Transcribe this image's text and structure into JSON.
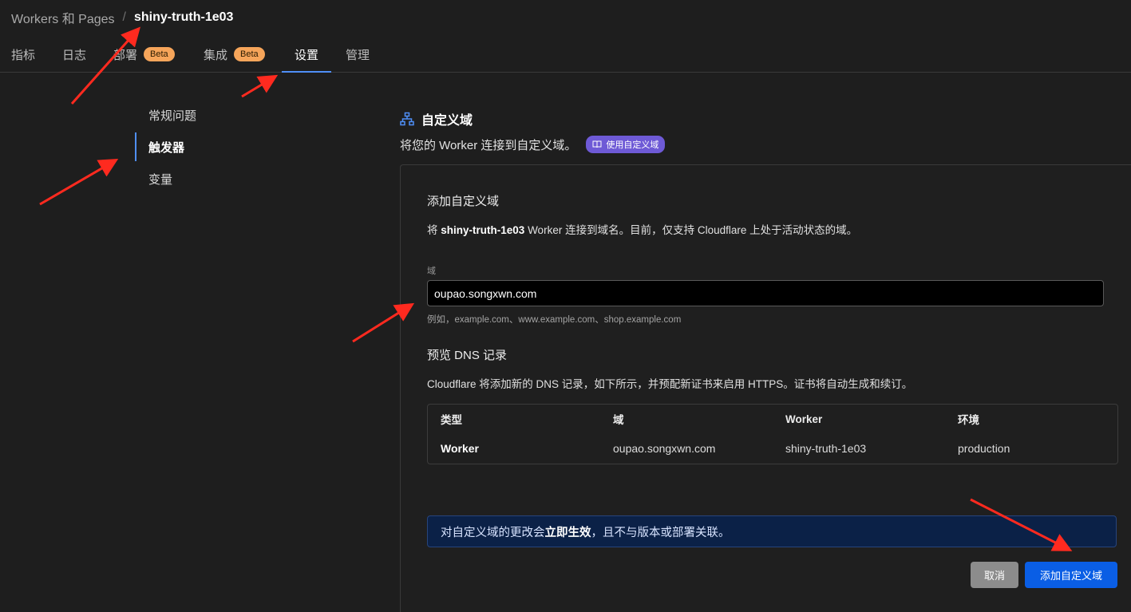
{
  "breadcrumb": {
    "parent": "Workers 和 Pages",
    "separator": "/",
    "current": "shiny-truth-1e03"
  },
  "tabs": [
    {
      "label": "指标"
    },
    {
      "label": "日志"
    },
    {
      "label": "部署",
      "badge": "Beta"
    },
    {
      "label": "集成",
      "badge": "Beta"
    },
    {
      "label": "设置",
      "active": true
    },
    {
      "label": "管理"
    }
  ],
  "side_nav": [
    {
      "label": "常规问题"
    },
    {
      "label": "触发器",
      "active": true
    },
    {
      "label": "变量"
    }
  ],
  "section": {
    "icon": "sitemap-icon",
    "title": "自定义域",
    "description": "将您的 Worker 连接到自定义域。",
    "doc_badge": "使用自定义域"
  },
  "card": {
    "title": "添加自定义域",
    "desc_prefix": "将",
    "desc_worker": "shiny-truth-1e03",
    "desc_suffix": "Worker 连接到域名。目前，仅支持 Cloudflare 上处于活动状态的域。",
    "field_label": "域",
    "field_value": "oupao.songxwn.com",
    "field_hint": "例如，example.com、www.example.com、shop.example.com",
    "dns_title": "预览 DNS 记录",
    "dns_desc": "Cloudflare 将添加新的 DNS 记录，如下所示，并预配新证书来启用 HTTPS。证书将自动生成和续订。",
    "table": {
      "headers": [
        "类型",
        "域",
        "Worker",
        "环境"
      ],
      "row": [
        "Worker",
        "oupao.songxwn.com",
        "shiny-truth-1e03",
        "production"
      ]
    },
    "notice_prefix": "对自定义域的更改会",
    "notice_bold": "立即生效",
    "notice_suffix": "，且不与版本或部署关联。",
    "cancel_label": "取消",
    "add_label": "添加自定义域"
  },
  "colors": {
    "background": "#1e1e1e",
    "accent": "#4f8ff7",
    "beta_badge": "#f6a55a",
    "doc_badge": "#6e5ad6",
    "primary_button": "#0a5ee5",
    "annotation_arrow": "#ff2a1f"
  }
}
